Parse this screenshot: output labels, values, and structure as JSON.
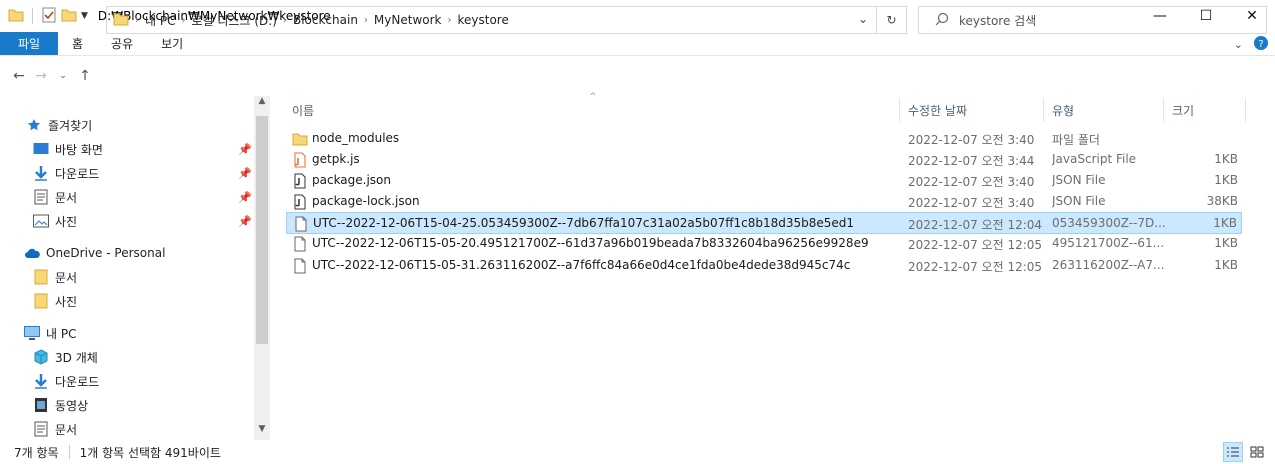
{
  "window": {
    "title_path": "D:₩Blockchain₩MyNetwork₩keystore",
    "controls": {
      "minimize": "—",
      "maximize": "☐",
      "close": "✕"
    }
  },
  "ribbon": {
    "tabs": [
      {
        "label": "파일"
      },
      {
        "label": "홈"
      },
      {
        "label": "공유"
      },
      {
        "label": "보기"
      }
    ]
  },
  "address": {
    "crumbs": [
      "내 PC",
      "로컬 디스크 (D:)",
      "Blockchain",
      "MyNetwork",
      "keystore"
    ],
    "search_placeholder": "keystore 검색"
  },
  "nav": {
    "items": [
      {
        "label": "즐겨찾기",
        "icon": "star-icon",
        "pinned": false
      },
      {
        "label": "바탕 화면",
        "icon": "desktop-icon",
        "pinned": true
      },
      {
        "label": "다운로드",
        "icon": "download-icon",
        "pinned": true
      },
      {
        "label": "문서",
        "icon": "document-icon",
        "pinned": true
      },
      {
        "label": "사진",
        "icon": "pictures-icon",
        "pinned": true
      },
      {
        "label": "OneDrive - Personal",
        "icon": "cloud-icon",
        "pinned": false
      },
      {
        "label": "문서",
        "icon": "folder-icon",
        "pinned": false
      },
      {
        "label": "사진",
        "icon": "folder-icon",
        "pinned": false
      },
      {
        "label": "내 PC",
        "icon": "pc-icon",
        "pinned": false
      },
      {
        "label": "3D 개체",
        "icon": "cube-icon",
        "pinned": false
      },
      {
        "label": "다운로드",
        "icon": "download-icon",
        "pinned": false
      },
      {
        "label": "동영상",
        "icon": "video-icon",
        "pinned": false
      },
      {
        "label": "문서",
        "icon": "document-icon",
        "pinned": false
      }
    ]
  },
  "columns": {
    "name": "이름",
    "date": "수정한 날짜",
    "type": "유형",
    "size": "크기"
  },
  "files": [
    {
      "name": "node_modules",
      "date": "2022-12-07 오전 3:40",
      "type": "파일 폴더",
      "size": "",
      "icon": "folder-icon",
      "selected": false
    },
    {
      "name": "getpk.js",
      "date": "2022-12-07 오전 3:44",
      "type": "JavaScript File",
      "size": "1KB",
      "icon": "js-file-icon",
      "selected": false
    },
    {
      "name": "package.json",
      "date": "2022-12-07 오전 3:40",
      "type": "JSON File",
      "size": "1KB",
      "icon": "json-file-icon",
      "selected": false
    },
    {
      "name": "package-lock.json",
      "date": "2022-12-07 오전 3:40",
      "type": "JSON File",
      "size": "38KB",
      "icon": "json-file-icon",
      "selected": false
    },
    {
      "name": "UTC--2022-12-06T15-04-25.053459300Z--7db67ffa107c31a02a5b07ff1c8b18d35b8e5ed1",
      "date": "2022-12-07 오전 12:04",
      "type": "053459300Z--7D...",
      "size": "1KB",
      "icon": "file-icon",
      "selected": true
    },
    {
      "name": "UTC--2022-12-06T15-05-20.495121700Z--61d37a96b019beada7b8332604ba96256e9928e9",
      "date": "2022-12-07 오전 12:05",
      "type": "495121700Z--61...",
      "size": "1KB",
      "icon": "file-icon",
      "selected": false
    },
    {
      "name": "UTC--2022-12-06T15-05-31.263116200Z--a7f6ffc84a66e0d4ce1fda0be4dede38d945c74c",
      "date": "2022-12-07 오전 12:05",
      "type": "263116200Z--A7...",
      "size": "1KB",
      "icon": "file-icon",
      "selected": false
    }
  ],
  "status": {
    "count": "7개 항목",
    "selection": "1개 항목 선택함 491바이트"
  }
}
